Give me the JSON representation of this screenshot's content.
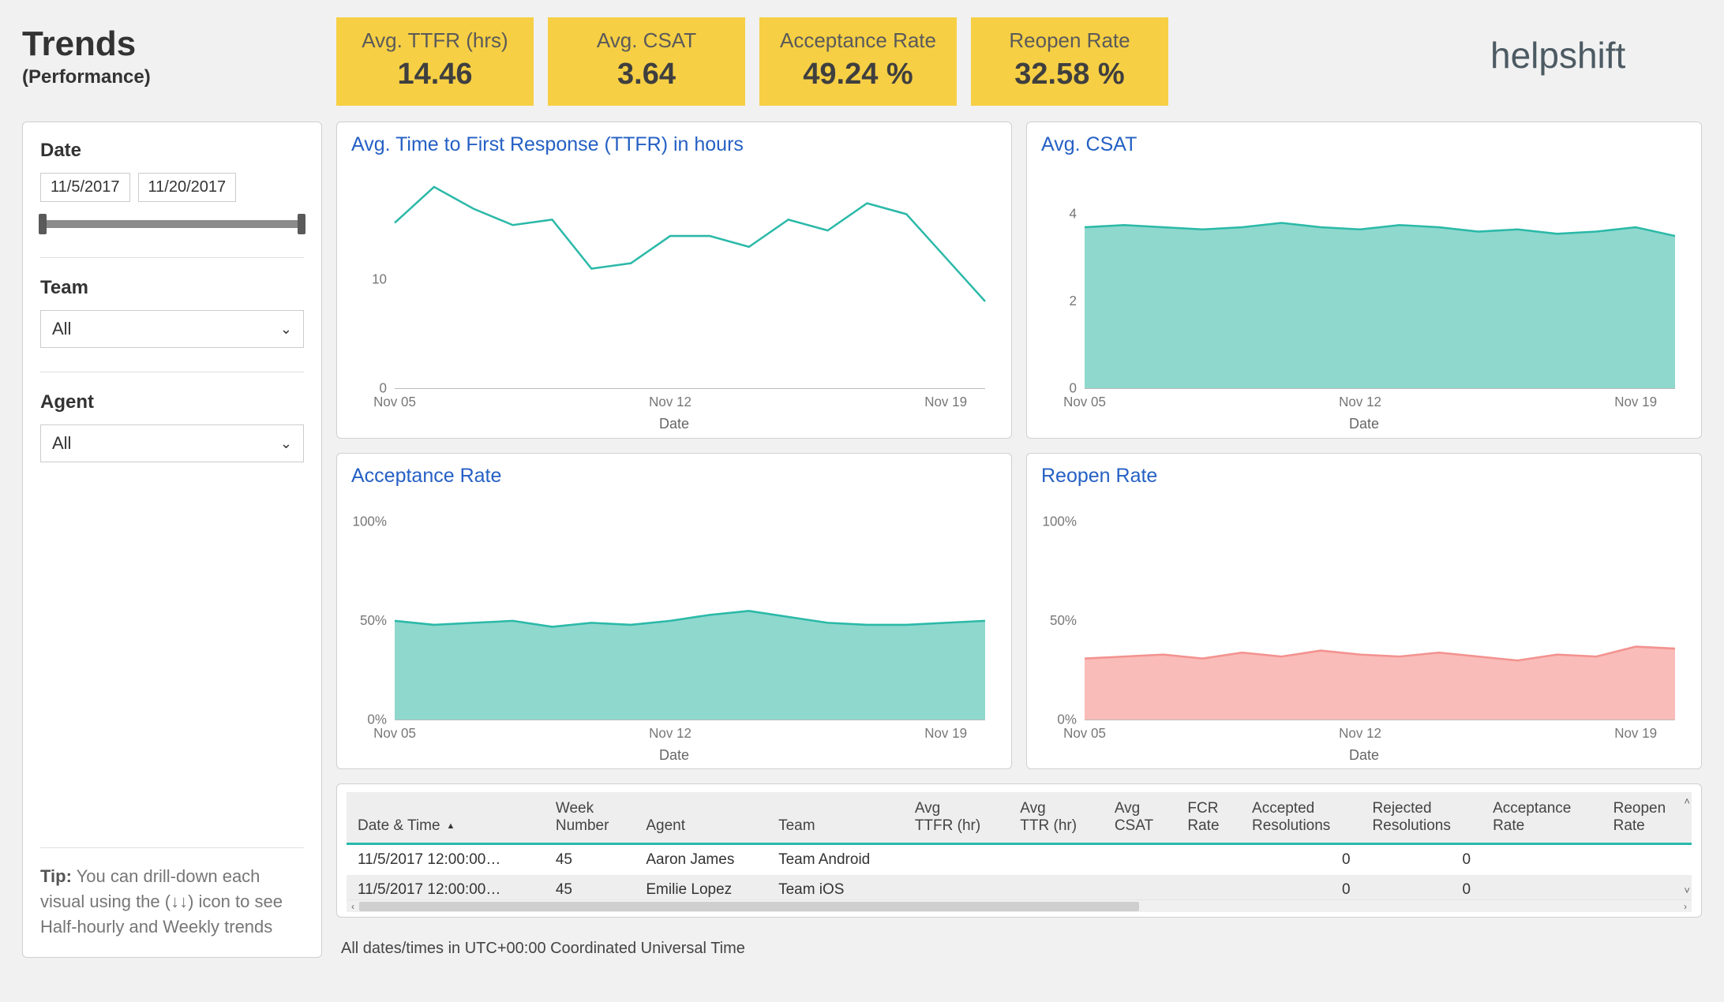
{
  "title": "Trends",
  "subtitle": "(Performance)",
  "logo_text": "helpshift",
  "kpis": [
    {
      "label": "Avg. TTFR (hrs)",
      "value": "14.46"
    },
    {
      "label": "Avg. CSAT",
      "value": "3.64"
    },
    {
      "label": "Acceptance Rate",
      "value": "49.24 %"
    },
    {
      "label": "Reopen Rate",
      "value": "32.58 %"
    }
  ],
  "filters": {
    "date_label": "Date",
    "date_from": "11/5/2017",
    "date_to": "11/20/2017",
    "team_label": "Team",
    "team_value": "All",
    "agent_label": "Agent",
    "agent_value": "All"
  },
  "tip_label": "Tip:",
  "tip_text": "  You can drill-down each visual using the (↓↓) icon to see Half-hourly and Weekly trends",
  "charts": {
    "ttfr": {
      "title": "Avg. Time to First Response (TTFR) in hours",
      "xlabel": "Date"
    },
    "csat": {
      "title": "Avg. CSAT",
      "xlabel": "Date"
    },
    "acceptance": {
      "title": "Acceptance Rate",
      "xlabel": "Date"
    },
    "reopen": {
      "title": "Reopen Rate",
      "xlabel": "Date"
    }
  },
  "chart_data": [
    {
      "id": "ttfr",
      "type": "line",
      "title": "Avg. Time to First Response (TTFR) in hours",
      "xlabel": "Date",
      "ylabel": "",
      "ylim": [
        0,
        20
      ],
      "yticks": [
        0,
        10
      ],
      "xticks": [
        "Nov 05",
        "Nov 12",
        "Nov 19"
      ],
      "categories": [
        "Nov 05",
        "Nov 06",
        "Nov 07",
        "Nov 08",
        "Nov 09",
        "Nov 10",
        "Nov 11",
        "Nov 12",
        "Nov 13",
        "Nov 14",
        "Nov 15",
        "Nov 16",
        "Nov 17",
        "Nov 18",
        "Nov 19",
        "Nov 20"
      ],
      "values": [
        15.2,
        18.5,
        16.5,
        15.0,
        15.5,
        11.0,
        11.5,
        14.0,
        14.0,
        13.0,
        15.5,
        14.5,
        17.0,
        16.0,
        12.0,
        8.0
      ],
      "color": "#2bb9a8",
      "fill": false
    },
    {
      "id": "csat",
      "type": "area",
      "title": "Avg. CSAT",
      "xlabel": "Date",
      "ylabel": "",
      "ylim": [
        0,
        5
      ],
      "yticks": [
        0,
        2,
        4
      ],
      "xticks": [
        "Nov 05",
        "Nov 12",
        "Nov 19"
      ],
      "categories": [
        "Nov 05",
        "Nov 06",
        "Nov 07",
        "Nov 08",
        "Nov 09",
        "Nov 10",
        "Nov 11",
        "Nov 12",
        "Nov 13",
        "Nov 14",
        "Nov 15",
        "Nov 16",
        "Nov 17",
        "Nov 18",
        "Nov 19",
        "Nov 20"
      ],
      "values": [
        3.7,
        3.75,
        3.7,
        3.65,
        3.7,
        3.8,
        3.7,
        3.65,
        3.75,
        3.7,
        3.6,
        3.65,
        3.55,
        3.6,
        3.7,
        3.5
      ],
      "color": "#2bb9a8",
      "fill": true,
      "fillColor": "#8fd8cd"
    },
    {
      "id": "acceptance",
      "type": "area",
      "title": "Acceptance Rate",
      "xlabel": "Date",
      "ylabel": "",
      "ylim": [
        0,
        110
      ],
      "percent": true,
      "yticks": [
        0,
        50,
        100
      ],
      "xticks": [
        "Nov 05",
        "Nov 12",
        "Nov 19"
      ],
      "categories": [
        "Nov 05",
        "Nov 06",
        "Nov 07",
        "Nov 08",
        "Nov 09",
        "Nov 10",
        "Nov 11",
        "Nov 12",
        "Nov 13",
        "Nov 14",
        "Nov 15",
        "Nov 16",
        "Nov 17",
        "Nov 18",
        "Nov 19",
        "Nov 20"
      ],
      "values": [
        50,
        48,
        49,
        50,
        47,
        49,
        48,
        50,
        53,
        55,
        52,
        49,
        48,
        48,
        49,
        50
      ],
      "color": "#2bb9a8",
      "fill": true,
      "fillColor": "#8fd8cd"
    },
    {
      "id": "reopen",
      "type": "area",
      "title": "Reopen Rate",
      "xlabel": "Date",
      "ylabel": "",
      "ylim": [
        0,
        110
      ],
      "percent": true,
      "yticks": [
        0,
        50,
        100
      ],
      "xticks": [
        "Nov 05",
        "Nov 12",
        "Nov 19"
      ],
      "categories": [
        "Nov 05",
        "Nov 06",
        "Nov 07",
        "Nov 08",
        "Nov 09",
        "Nov 10",
        "Nov 11",
        "Nov 12",
        "Nov 13",
        "Nov 14",
        "Nov 15",
        "Nov 16",
        "Nov 17",
        "Nov 18",
        "Nov 19",
        "Nov 20"
      ],
      "values": [
        31,
        32,
        33,
        31,
        34,
        32,
        35,
        33,
        32,
        34,
        32,
        30,
        33,
        32,
        37,
        36
      ],
      "color": "#f3928f",
      "fill": true,
      "fillColor": "#f9bcb9"
    }
  ],
  "table": {
    "columns": [
      "Date & Time",
      "Week Number",
      "Agent",
      "Team",
      "Avg TTFR (hr)",
      "Avg TTR (hr)",
      "Avg CSAT",
      "FCR Rate",
      "Accepted Resolutions",
      "Rejected Resolutions",
      "Acceptance Rate",
      "Reopen Rate"
    ],
    "sort_column_index": 0,
    "rows": [
      {
        "datetime": "11/5/2017 12:00:00…",
        "week": "45",
        "agent": "Aaron James",
        "team": "Team Android",
        "avg_ttfr": "",
        "avg_ttr": "",
        "avg_csat": "",
        "fcr": "",
        "accepted": "0",
        "rejected": "0",
        "acceptance": "",
        "reopen": ""
      },
      {
        "datetime": "11/5/2017 12:00:00…",
        "week": "45",
        "agent": "Emilie Lopez",
        "team": "Team iOS",
        "avg_ttfr": "",
        "avg_ttr": "",
        "avg_csat": "",
        "fcr": "",
        "accepted": "0",
        "rejected": "0",
        "acceptance": "",
        "reopen": ""
      }
    ]
  },
  "footer_note": "All dates/times in UTC+00:00 Coordinated Universal Time"
}
